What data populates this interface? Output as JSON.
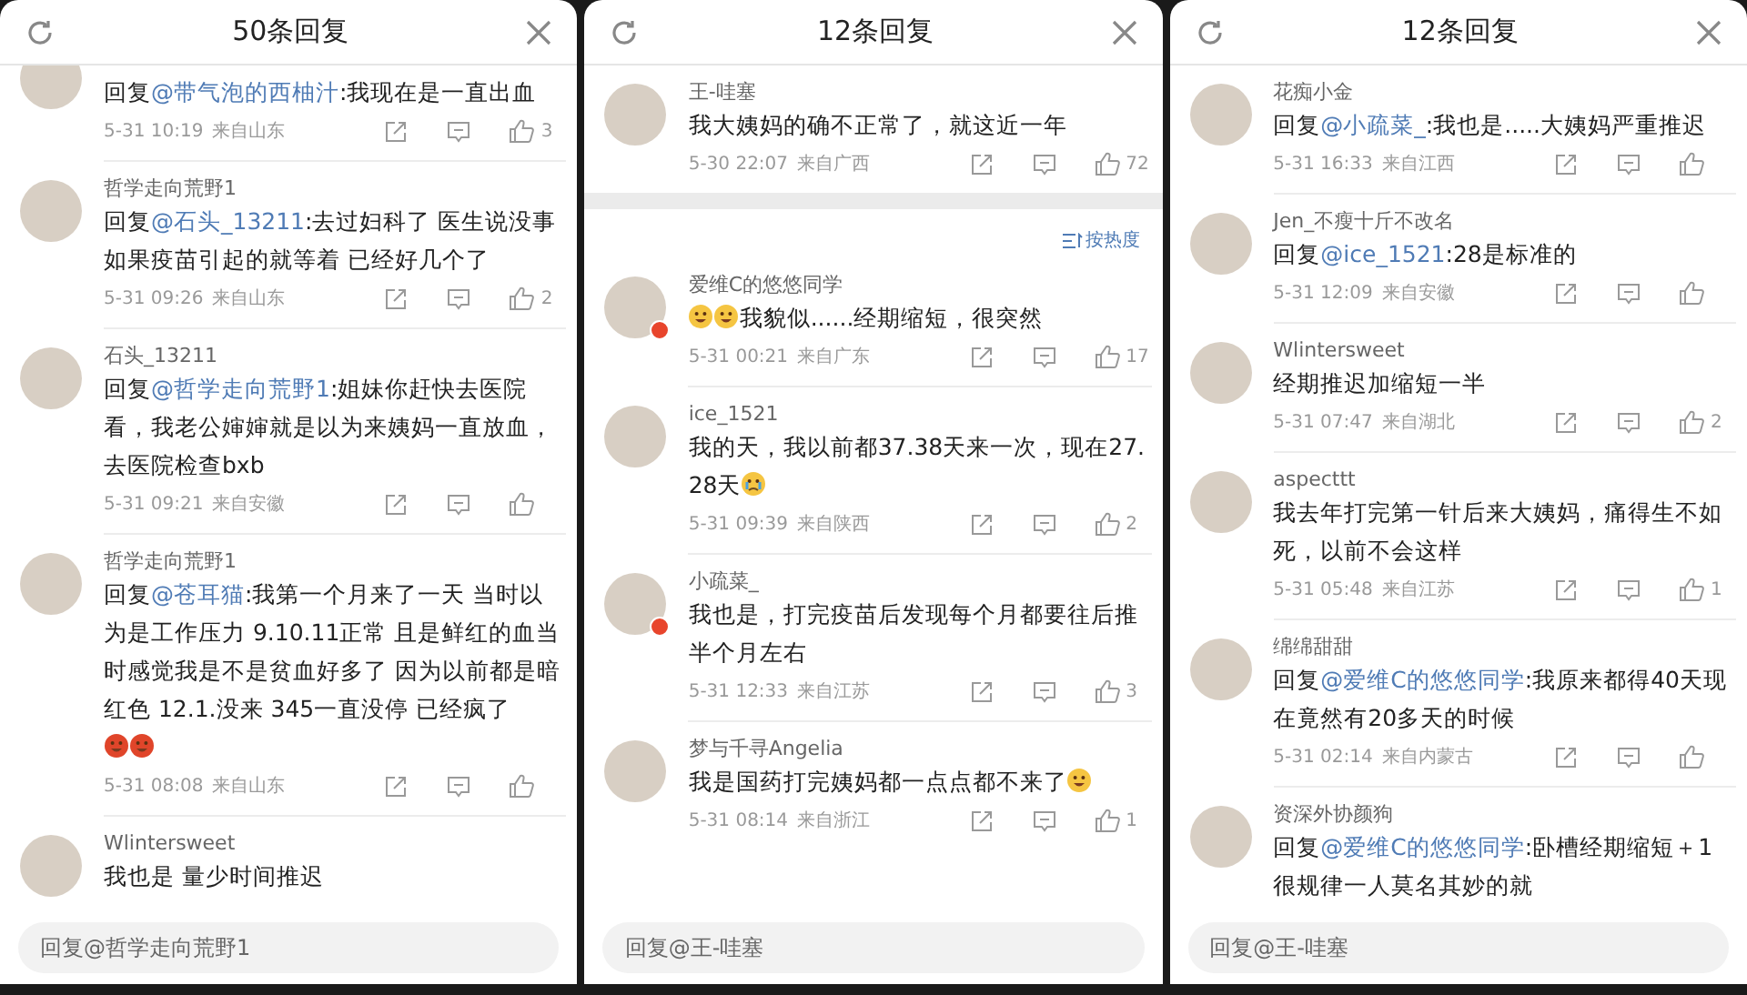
{
  "panels": [
    {
      "title": "50条回复",
      "comments": [
        {
          "reply_prefix": "回复",
          "reply_to": "@带气泡的西柚汁",
          "text": ":我现在是一直出血",
          "time": "5-31 10:19",
          "location": "来自山东",
          "likes": "3"
        },
        {
          "name": "哲学走向荒野1",
          "reply_prefix": "回复",
          "reply_to": "@石头_13211",
          "text": ":去过妇科了 医生说没事如果疫苗引起的就等着 已经好几个了",
          "time": "5-31 09:26",
          "location": "来自山东",
          "likes": "2"
        },
        {
          "name": "石头_13211",
          "reply_prefix": "回复",
          "reply_to": "@哲学走向荒野1",
          "text": ":姐妹你赶快去医院看，我老公婶婶就是以为来姨妈一直放血，去医院检查bxb",
          "time": "5-31 09:21",
          "location": "来自安徽"
        },
        {
          "name": "哲学走向荒野1",
          "reply_prefix": "回复",
          "reply_to": "@苍耳猫",
          "text": ":我第一个月来了一天 当时以为是工作压力 9.10.11正常 且是鲜红的血当时感觉我是不是贫血好多了 因为以前都是暗红色 12.1.没来 345一直没停 已经疯了",
          "emoji_line": [
            {
              "kind": "angry"
            },
            {
              "kind": "angry"
            }
          ],
          "time": "5-31 08:08",
          "location": "来自山东"
        },
        {
          "name": "Wlintersweet",
          "text": "我也是 量少时间推迟"
        }
      ],
      "input": {
        "placeholder": "回复@哲学走向荒野1"
      }
    },
    {
      "title": "12条回复",
      "pinned": {
        "name": "王-哇塞",
        "text": "我大姨妈的确不正常了，就这近一年",
        "time": "5-30 22:07",
        "location": "来自广西",
        "likes": "72"
      },
      "sort": {
        "label": "按热度"
      },
      "comments": [
        {
          "name": "爱维C的悠悠同学",
          "badge": true,
          "lead_emojis": [
            {
              "kind": "grin"
            },
            {
              "kind": "grin"
            }
          ],
          "text": "我貌似......经期缩短，很突然",
          "time": "5-31 00:21",
          "location": "来自广东",
          "likes": "17"
        },
        {
          "name": "ice_1521",
          "text": "我的天，我以前都37.38天来一次，现在27.28天",
          "trail_emojis": [
            {
              "kind": "cry"
            }
          ],
          "time": "5-31 09:39",
          "location": "来自陕西",
          "likes": "2"
        },
        {
          "name": "小疏菜_",
          "badge": true,
          "text": "我也是，打完疫苗后发现每个月都要往后推半个月左右",
          "time": "5-31 12:33",
          "location": "来自江苏",
          "likes": "3"
        },
        {
          "name": "梦与千寻Angelia",
          "text": "我是国药打完姨妈都一点点都不来了",
          "trail_emojis": [
            {
              "kind": "laugh"
            }
          ],
          "time": "5-31 08:14",
          "location": "来自浙江",
          "likes": "1"
        }
      ],
      "input": {
        "placeholder": "回复@王-哇塞"
      }
    },
    {
      "title": "12条回复",
      "comments": [
        {
          "name": "花痴小金",
          "reply_prefix": "回复",
          "reply_to": "@小疏菜_",
          "text": ":我也是.....大姨妈严重推迟",
          "time": "5-31 16:33",
          "location": "来自江西"
        },
        {
          "name": "Jen_不瘦十斤不改名",
          "reply_prefix": "回复",
          "reply_to": "@ice_1521",
          "text": ":28是标准的",
          "time": "5-31 12:09",
          "location": "来自安徽"
        },
        {
          "name": "Wlintersweet",
          "text": "经期推迟加缩短一半",
          "time": "5-31 07:47",
          "location": "来自湖北",
          "likes": "2"
        },
        {
          "name": "aspecttt",
          "text": "我去年打完第一针后来大姨妈，痛得生不如死，以前不会这样",
          "time": "5-31 05:48",
          "location": "来自江苏",
          "likes": "1"
        },
        {
          "name": "绵绵甜甜",
          "reply_prefix": "回复",
          "reply_to": "@爱维C的悠悠同学",
          "text": ":我原来都得40天现在竟然有20多天的时候",
          "time": "5-31 02:14",
          "location": "来自内蒙古"
        },
        {
          "name": "资深外协颜狗",
          "reply_prefix": "回复",
          "reply_to": "@爱维C的悠悠同学",
          "text": ":卧槽经期缩短＋1很规律一人莫名其妙的就"
        }
      ],
      "input": {
        "placeholder": "回复@王-哇塞"
      }
    }
  ]
}
